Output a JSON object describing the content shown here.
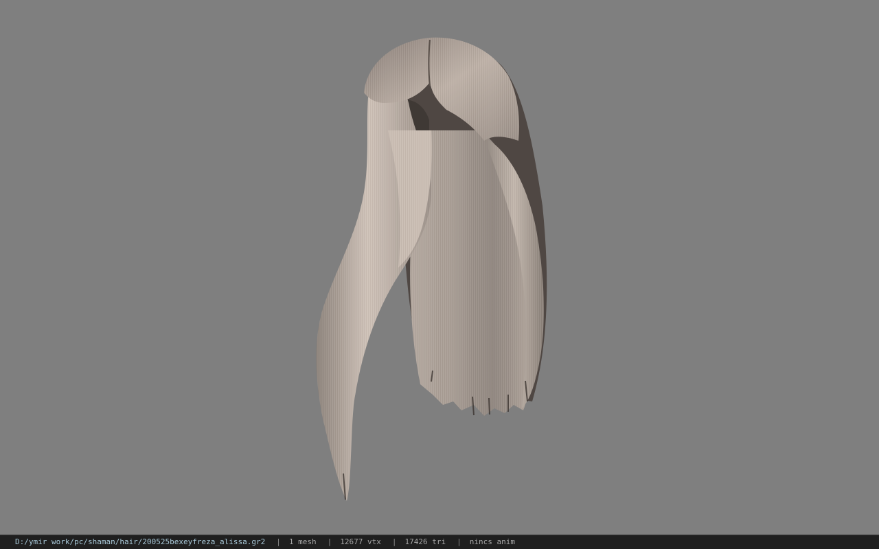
{
  "viewport": {
    "background": "#7f7f7f",
    "model": "hair-mesh",
    "hair_colors": {
      "light": "#cdbfb4",
      "mid": "#a0958c",
      "dark": "#5e5550"
    }
  },
  "statusbar": {
    "file_path": "D:/ymir work/pc/shaman/hair/200525bexeyfreza_alissa.gr2",
    "separator": "|",
    "mesh_count": "1 mesh",
    "vertex_count": "12677 vtx",
    "triangle_count": "17426 tri",
    "anim_status": "nincs anim"
  }
}
